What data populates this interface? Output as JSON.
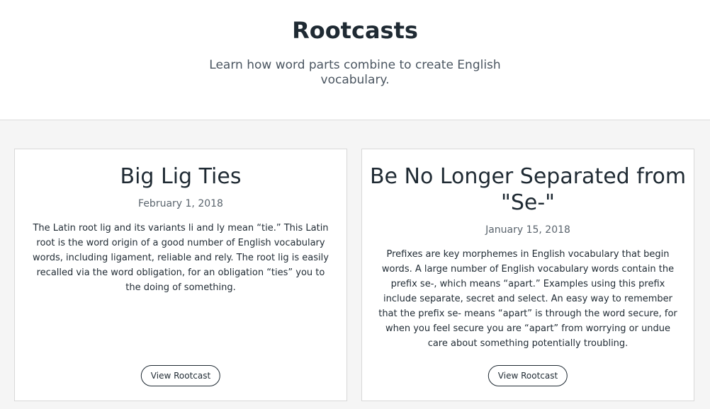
{
  "header": {
    "title": "Rootcasts",
    "subtitle": "Learn how word parts combine to create English vocabulary."
  },
  "cards": [
    {
      "title": "Big Lig Ties",
      "date": "February 1, 2018",
      "excerpt": "The Latin root lig and its variants li and ly mean “tie.” This Latin root is the word origin of a good number of English vocabulary words, including ligament, reliable and rely. The root lig is easily recalled via the word obligation, for an obligation “ties” you to the doing of something.",
      "button_label": "View Rootcast"
    },
    {
      "title": "Be No Longer Separated from \"Se-\"",
      "date": "January 15, 2018",
      "excerpt": "Prefixes are key morphemes in English vocabulary that begin words. A large number of English vocabulary words contain the prefix se-, which means “apart.” Examples using this prefix include separate, secret and select. An easy way to remember that the prefix se- means “apart” is through the word secure, for when you feel secure you are “apart” from worrying or undue care about something potentially troubling.",
      "button_label": "View Rootcast"
    }
  ]
}
